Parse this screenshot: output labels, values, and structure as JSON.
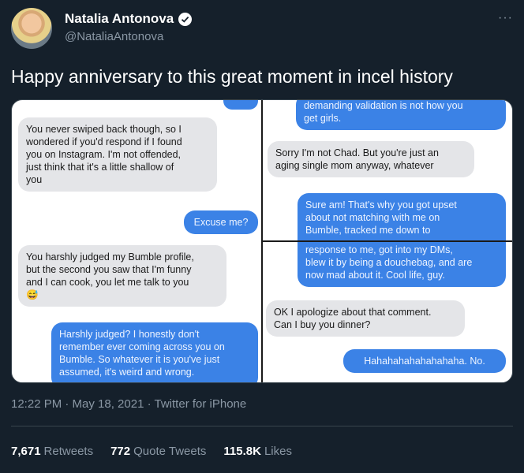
{
  "author": {
    "display_name": "Natalia Antonova",
    "handle": "@NataliaAntonova"
  },
  "tweet": {
    "text": "Happy anniversary to this great moment in incel history",
    "timestamp": "12:22 PM · May 18, 2021",
    "source": "Twitter for iPhone"
  },
  "stats": {
    "retweets": {
      "count": "7,671",
      "label": "Retweets"
    },
    "quotes": {
      "count": "772",
      "label": "Quote Tweets"
    },
    "likes": {
      "count": "115.8K",
      "label": "Likes"
    }
  },
  "screenshot": {
    "left_panel": [
      {
        "side": "received",
        "text": "You never swiped back though, so I\nwondered if you'd respond if I found\nyou on Instagram. I'm not offended,\njust think that it's a little shallow of\nyou"
      },
      {
        "side": "sent",
        "text": "Excuse me?"
      },
      {
        "side": "received",
        "text": "You harshly judged my Bumble profile,\nbut the second you saw that I'm funny\nand I can cook, you let me talk to you\n😅"
      },
      {
        "side": "sent",
        "text": "Harshly judged? I honestly don't\nremember ever coming across you on\nBumble. So whatever it is you've just\nassumed, it's weird and wrong."
      }
    ],
    "right_top": [
      {
        "side": "sent",
        "text": "demanding validation is not how you\nget girls."
      },
      {
        "side": "received",
        "text": "Sorry I'm not Chad. But you're just an\naging single mom anyway, whatever"
      },
      {
        "side": "sent",
        "text": "Sure am! That's why you got upset\nabout not matching with me on\nBumble, tracked me down to"
      }
    ],
    "right_bottom": [
      {
        "side": "sent",
        "text": "response to me, got into my DMs,\nblew it by being a douchebag, and are\nnow mad about it. Cool life, guy."
      },
      {
        "side": "received",
        "text": "OK I apologize about that comment.\nCan I buy you dinner?"
      },
      {
        "side": "sent",
        "text": "Hahahahahahahahaha. No."
      }
    ]
  },
  "colors": {
    "background": "#15202b",
    "secondary_text": "#8b98a5",
    "sent_bubble": "#3b82e6",
    "received_bubble": "#e4e5e8"
  }
}
